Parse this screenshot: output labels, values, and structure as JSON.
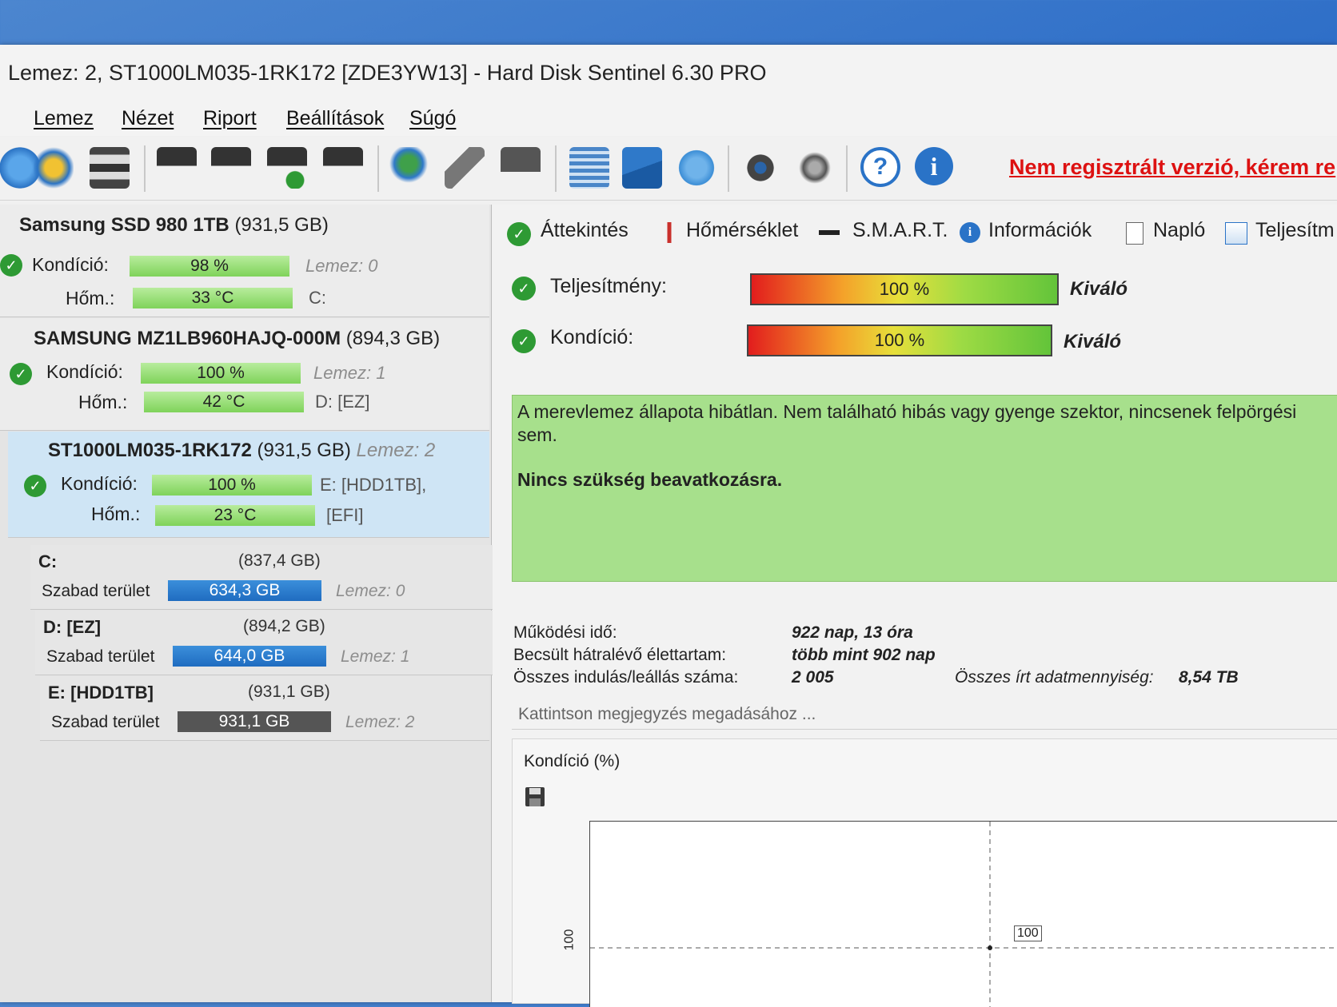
{
  "window": {
    "title": "Lemez: 2, ST1000LM035-1RK172 [ZDE3YW13]  -  Hard Disk Sentinel 6.30 PRO"
  },
  "menu": [
    "Lemez",
    "Nézet",
    "Riport",
    "Beállítások",
    "Súgó"
  ],
  "toolbar": {
    "icons": [
      "refresh-icon",
      "refresh-warning-icon",
      "disk-list-icon",
      "disk-tools-icon",
      "disk-clock-icon",
      "disk-check-icon",
      "disk-search-icon",
      "network-disk-icon",
      "satellite-icon",
      "usb-icon",
      "report-icon",
      "mail-icon",
      "cloud-icon",
      "gear-icon",
      "speaker-icon",
      "help-icon",
      "info-icon"
    ],
    "unregistered": "Nem regisztrált verzió, kérem re"
  },
  "disks": [
    {
      "name": "Samsung SSD 980 1TB",
      "size": "(931,5 GB)",
      "condition_label": "Kondíció:",
      "condition": "98 %",
      "condition_value": 98,
      "disk_label": "Lemez: 0",
      "temp_label": "Hőm.:",
      "temp": "33 °C",
      "drive": "C:"
    },
    {
      "name": "SAMSUNG MZ1LB960HAJQ-000M",
      "size": "(894,3 GB)",
      "condition_label": "Kondíció:",
      "condition": "100 %",
      "condition_value": 100,
      "disk_label": "Lemez: 1",
      "temp_label": "Hőm.:",
      "temp": "42 °C",
      "drive": "D: [EZ]"
    },
    {
      "name": "ST1000LM035-1RK172",
      "size": "(931,5 GB)",
      "condition_label": "Kondíció:",
      "condition": "100 %",
      "condition_value": 100,
      "disk_label": "Lemez: 2",
      "temp_label": "Hőm.:",
      "temp": "23 °C",
      "drive": "E: [HDD1TB],",
      "drive2": "[EFI]"
    }
  ],
  "volumes": [
    {
      "name": "C:",
      "size": "(837,4 GB)",
      "free_label": "Szabad terület",
      "free": "634,3 GB",
      "disk": "Lemez: 0"
    },
    {
      "name": "D: [EZ]",
      "size": "(894,2 GB)",
      "free_label": "Szabad terület",
      "free": "644,0 GB",
      "disk": "Lemez: 1"
    },
    {
      "name": "E: [HDD1TB]",
      "size": "(931,1 GB)",
      "free_label": "Szabad terület",
      "free": "931,1 GB",
      "disk": "Lemez: 2"
    }
  ],
  "tabs": [
    "Áttekintés",
    "Hőmérséklet",
    "S.M.A.R.T.",
    "Információk",
    "Napló",
    "Teljesítm"
  ],
  "overview": {
    "performance_label": "Teljesítmény:",
    "performance": "100 %",
    "performance_value": 100,
    "performance_grade": "Kiváló",
    "condition_label": "Kondíció:",
    "condition": "100 %",
    "condition_value": 100,
    "condition_grade": "Kiváló",
    "status_text": "A merevlemez állapota hibátlan. Nem található hibás vagy gyenge szektor, nincsenek felpörgési sem.",
    "status_action": "Nincs szükség beavatkozásra.",
    "uptime_label": "Működési idő:",
    "uptime": "922 nap, 13 óra",
    "lifetime_label": "Becsült hátralévő élettartam:",
    "lifetime": "több mint 902 nap",
    "startstop_label": "Összes indulás/leállás száma:",
    "startstop": "2 005",
    "written_label": "Összes írt adatmennyiség:",
    "written": "8,54 TB",
    "comment_placeholder": "Kattintson megjegyzés megadásához ..."
  },
  "chart_data": {
    "type": "line",
    "title": "Kondíció  (%)",
    "y_ticks": [
      100
    ],
    "values": [
      100
    ],
    "point_labels": [
      "100"
    ],
    "grid": true
  }
}
